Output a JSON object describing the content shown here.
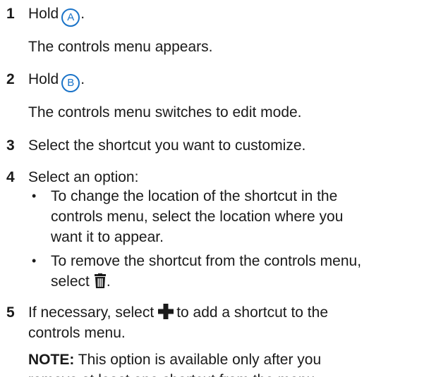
{
  "steps": [
    {
      "num": "1",
      "text_before": "Hold",
      "icon": "A",
      "text_after": ".",
      "result": "The controls menu appears."
    },
    {
      "num": "2",
      "text_before": "Hold",
      "icon": "B",
      "text_after": ".",
      "result": "The controls menu switches to edit mode."
    },
    {
      "num": "3",
      "text": "Select the shortcut you want to customize."
    },
    {
      "num": "4",
      "text": "Select an option:",
      "bullets": [
        {
          "lines": [
            "To change the location of the shortcut in the",
            "controls menu, select the location where you",
            "want it to appear."
          ]
        },
        {
          "lines": [
            "To remove the shortcut from the controls menu,"
          ],
          "last_line": "select",
          "icon": "trash-icon",
          "last_after": "."
        }
      ]
    },
    {
      "num": "5",
      "text_before": "If necessary, select",
      "icon": "plus-icon",
      "text_after": "to add a shortcut to the",
      "line2": "controls menu."
    }
  ],
  "note": {
    "label": "NOTE:",
    "line1": "This option is available only after you",
    "line2": "remove at least one shortcut from the menu."
  },
  "colors": {
    "accent": "#1a73c8",
    "text": "#1a1a1a"
  }
}
